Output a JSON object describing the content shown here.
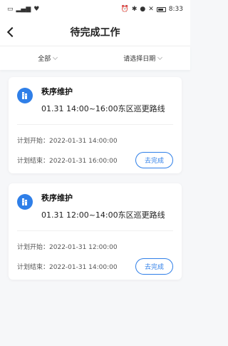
{
  "status_bar": {
    "time": "8:33"
  },
  "header": {
    "title": "待完成工作"
  },
  "filters": {
    "type": "全部",
    "date": "请选择日期"
  },
  "labels": {
    "plan_start": "计划开始：",
    "plan_end": "计划结束：",
    "action": "去完成"
  },
  "cards": [
    {
      "title": "秩序维护",
      "desc": "01.31 14:00~16:00东区巡更路线",
      "start": "2022-01-31 14:00:00",
      "end": "2022-01-31 16:00:00"
    },
    {
      "title": "秩序维护",
      "desc": "01.31 12:00~14:00东区巡更路线",
      "start": "2022-01-31 12:00:00",
      "end": "2022-01-31 14:00:00"
    }
  ],
  "colors": {
    "accent": "#2f7fe8",
    "background": "#f6f7f9"
  }
}
